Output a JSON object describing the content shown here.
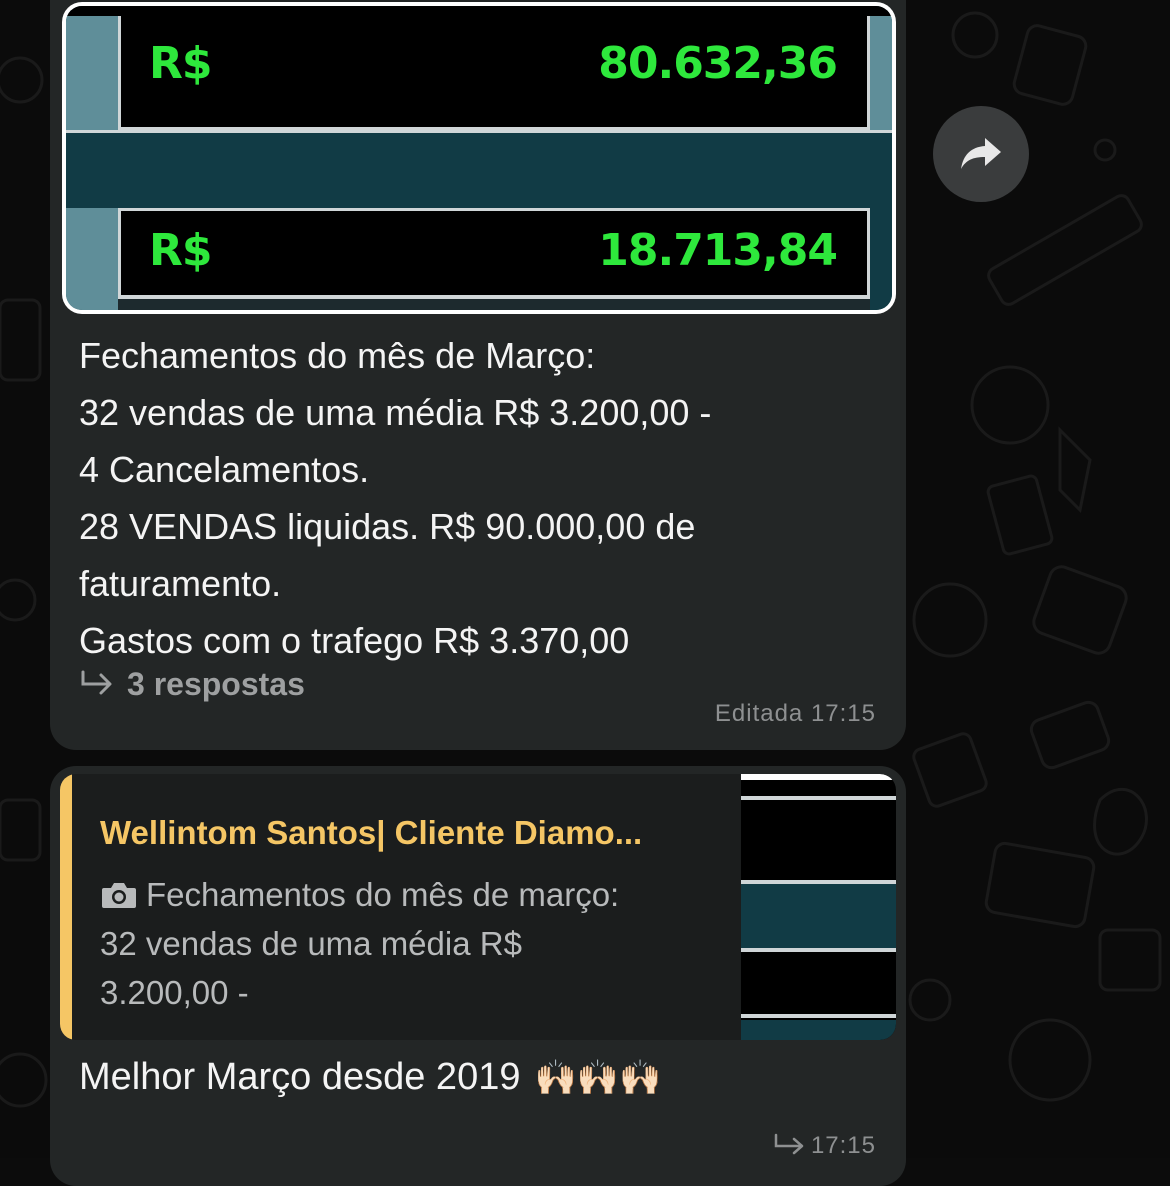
{
  "message1": {
    "image": {
      "rows": [
        {
          "currency": "R$",
          "amount": "80.632,36"
        },
        {
          "currency": "R$",
          "amount": "18.713,84"
        }
      ]
    },
    "lines": [
      "Fechamentos do mês de Março:",
      "32 vendas de uma média R$ 3.200,00 -",
      "4 Cancelamentos.",
      "28 VENDAS liquidas. R$ 90.000,00 de",
      "faturamento.",
      "Gastos com o trafego R$ 3.370,00"
    ],
    "replies_label": "3 respostas",
    "timestamp": "Editada 17:15"
  },
  "forward_button": {
    "icon": "forward-arrow-icon"
  },
  "message2": {
    "quote": {
      "author": "Wellintom Santos| Cliente Diamo...",
      "camera_icon": "camera-icon",
      "lines": [
        "Fechamentos do mês de março:",
        "32 vendas de uma média R$",
        "3.200,00 -"
      ]
    },
    "text": "Melhor Março desde 2019",
    "emoji": "🙌🏻🙌🏻🙌🏻",
    "timestamp": "17:15"
  },
  "colors": {
    "background": "#0b0b0b",
    "bubble": "#232626",
    "quote_accent": "#f5c665",
    "green_value": "#2ee83c",
    "muted_text": "#8e9091"
  }
}
